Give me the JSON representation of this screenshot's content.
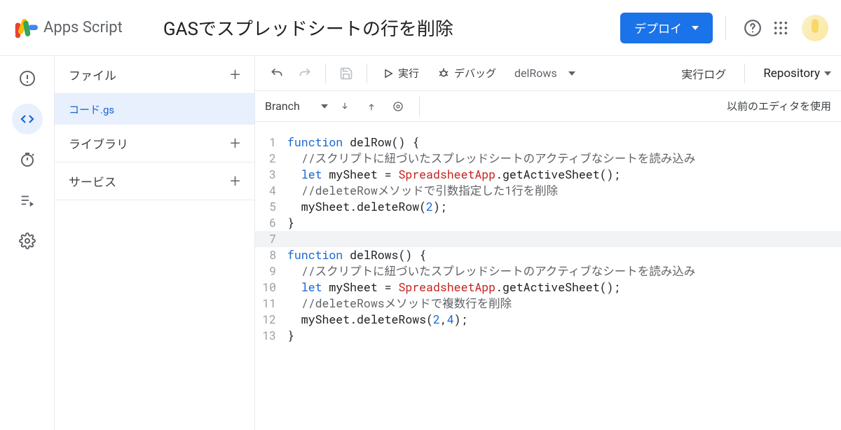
{
  "header": {
    "product": "Apps Script",
    "title": "GASでスプレッドシートの行を削除",
    "deploy": "デプロイ"
  },
  "filesPane": {
    "files_label": "ファイル",
    "library_label": "ライブラリ",
    "services_label": "サービス",
    "file_name": "コード.gs"
  },
  "toolbar": {
    "run": "実行",
    "debug": "デバッグ",
    "function_selected": "delRows",
    "log": "実行ログ",
    "repository": "Repository"
  },
  "branchbar": {
    "branch_label": "Branch",
    "legacy_editor": "以前のエディタを使用"
  },
  "code": {
    "lines": [
      {
        "n": "1",
        "seg": [
          {
            "t": "function ",
            "c": "kw"
          },
          {
            "t": "delRow",
            "c": "fn"
          },
          {
            "t": "() {",
            "c": "pl"
          }
        ]
      },
      {
        "n": "2",
        "seg": [
          {
            "t": "  ",
            "c": "pl"
          },
          {
            "t": "//スクリプトに紐づいたスプレッドシートのアクティブなシートを読み込み",
            "c": "cm"
          }
        ]
      },
      {
        "n": "3",
        "seg": [
          {
            "t": "  ",
            "c": "pl"
          },
          {
            "t": "let ",
            "c": "kw"
          },
          {
            "t": "mySheet = ",
            "c": "pl"
          },
          {
            "t": "SpreadsheetApp",
            "c": "cls"
          },
          {
            "t": ".getActiveSheet();",
            "c": "pl"
          }
        ]
      },
      {
        "n": "4",
        "seg": [
          {
            "t": "  ",
            "c": "pl"
          },
          {
            "t": "//deleteRowメソッドで引数指定した1行を削除",
            "c": "cm"
          }
        ]
      },
      {
        "n": "5",
        "seg": [
          {
            "t": "  mySheet.deleteRow(",
            "c": "pl"
          },
          {
            "t": "2",
            "c": "num"
          },
          {
            "t": ");",
            "c": "pl"
          }
        ]
      },
      {
        "n": "6",
        "seg": [
          {
            "t": "}",
            "c": "pl"
          }
        ]
      },
      {
        "n": "7",
        "seg": [
          {
            "t": "",
            "c": "pl"
          }
        ],
        "cur": true
      },
      {
        "n": "8",
        "seg": [
          {
            "t": "function ",
            "c": "kw"
          },
          {
            "t": "delRows",
            "c": "fn"
          },
          {
            "t": "() {",
            "c": "pl"
          }
        ]
      },
      {
        "n": "9",
        "seg": [
          {
            "t": "  ",
            "c": "pl"
          },
          {
            "t": "//スクリプトに紐づいたスプレッドシートのアクティブなシートを読み込み",
            "c": "cm"
          }
        ]
      },
      {
        "n": "10",
        "seg": [
          {
            "t": "  ",
            "c": "pl"
          },
          {
            "t": "let ",
            "c": "kw"
          },
          {
            "t": "mySheet = ",
            "c": "pl"
          },
          {
            "t": "SpreadsheetApp",
            "c": "cls"
          },
          {
            "t": ".getActiveSheet();",
            "c": "pl"
          }
        ]
      },
      {
        "n": "11",
        "seg": [
          {
            "t": "  ",
            "c": "pl"
          },
          {
            "t": "//deleteRowsメソッドで複数行を削除",
            "c": "cm"
          }
        ]
      },
      {
        "n": "12",
        "seg": [
          {
            "t": "  mySheet.deleteRows(",
            "c": "pl"
          },
          {
            "t": "2",
            "c": "num"
          },
          {
            "t": ",",
            "c": "pl"
          },
          {
            "t": "4",
            "c": "num"
          },
          {
            "t": ");",
            "c": "pl"
          }
        ]
      },
      {
        "n": "13",
        "seg": [
          {
            "t": "}",
            "c": "pl"
          }
        ]
      }
    ]
  }
}
